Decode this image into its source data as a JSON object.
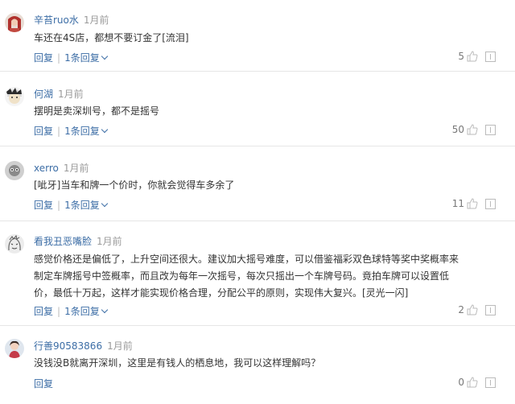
{
  "comments": [
    {
      "user": "辛苔ruo水",
      "time": "1月前",
      "text": "车还在4S店，都想不要订金了[流泪]",
      "reply_label": "回复",
      "replies_label": "1条回复",
      "likes": "5",
      "avatar": "avatar-red-hair"
    },
    {
      "user": "何湖",
      "time": "1月前",
      "text": "摆明是卖深圳号，都不是摇号",
      "reply_label": "回复",
      "replies_label": "1条回复",
      "likes": "50",
      "avatar": "avatar-cartoon"
    },
    {
      "user": "xerro",
      "time": "1月前",
      "text": "[呲牙]当车和牌一个价时，你就会觉得车多余了",
      "reply_label": "回复",
      "replies_label": "1条回复",
      "likes": "11",
      "avatar": "avatar-grey"
    },
    {
      "user": "看我丑恶嘴脸",
      "time": "1月前",
      "text_lines": [
        "感觉价格还是偏低了，上升空间还很大。建议加大摇号难度，可以借鉴福彩双色球特等奖中奖概率来",
        "制定车牌摇号中签概率，而且改为每年一次摇号，每次只摇出一个车牌号码。竟拍车牌可以设置低",
        "价，最低十万起，这样才能实现价格合理，分配公平的原则，实现伟大复兴。[灵光一闪]"
      ],
      "reply_label": "回复",
      "replies_label": "1条回复",
      "likes": "2",
      "avatar": "avatar-sketch"
    },
    {
      "user": "行善90583866",
      "time": "1月前",
      "text": "没钱没B就离开深圳，这里是有钱人的栖息地，我可以这样理解吗？",
      "reply_label": "回复",
      "likes": "0",
      "avatar": "avatar-woman"
    }
  ],
  "colors": {
    "link": "#3d6ea6",
    "meta": "#9a9a9a",
    "text": "#333333"
  },
  "icons": {
    "like": "thumbs-up-icon",
    "report": "report-icon",
    "expand": "chevron-down-icon"
  }
}
